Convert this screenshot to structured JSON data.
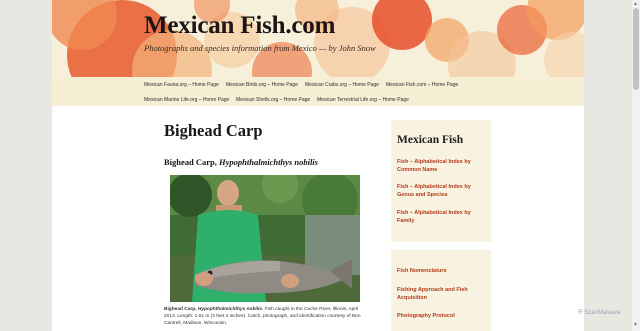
{
  "header": {
    "site_title": "Mexican Fish.com",
    "tagline": "Photographs and species information from Mexico — by John Snow"
  },
  "nav": {
    "row1": [
      "Mexican Fauna.org – Home Page",
      "Mexican Birds.org – Home Page",
      "Mexican Crabs.org – Home Page",
      "Mexican Fish.com – Home Page"
    ],
    "row2": [
      "Mexican Marine Life.org – Home Page",
      "Mexican Shells.org – Home Page",
      "Mexican Terrestrial Life.org – Home Page"
    ],
    "search_icon": "search-icon"
  },
  "main": {
    "title": "Bighead Carp",
    "subtitle_common": "Bighead Carp, ",
    "subtitle_scientific": "Hypophthalmichthys nobilis",
    "caption_bold": "Bighead Carp, ",
    "caption_sci": "Hypophthalmichthys nobilis.",
    "caption_text": " Fish caught in the Cache River, Illinois, April 2013. Length: 1.01 m (3 feet 4 inches). Catch, photograph, and identification courtesy of Ben Cantrell, Madison, Wisconsin."
  },
  "sidebar": {
    "widget_title": "Mexican Fish",
    "links1": [
      "Fish – Alphabetical Index by Common Name",
      "Fish – Alphabetical Index by Genus and Species",
      "Fish – Alphabetical Index by Family"
    ],
    "links2": [
      "Fish Nomenclature",
      "Fishing Approach and Fish Acquisition",
      "Photography Protocol"
    ]
  },
  "badge": "ScanMalware",
  "colors": {
    "link": "#b23a1b",
    "header_bg": "#f6f0da",
    "accent_orange": "#e8562a"
  }
}
